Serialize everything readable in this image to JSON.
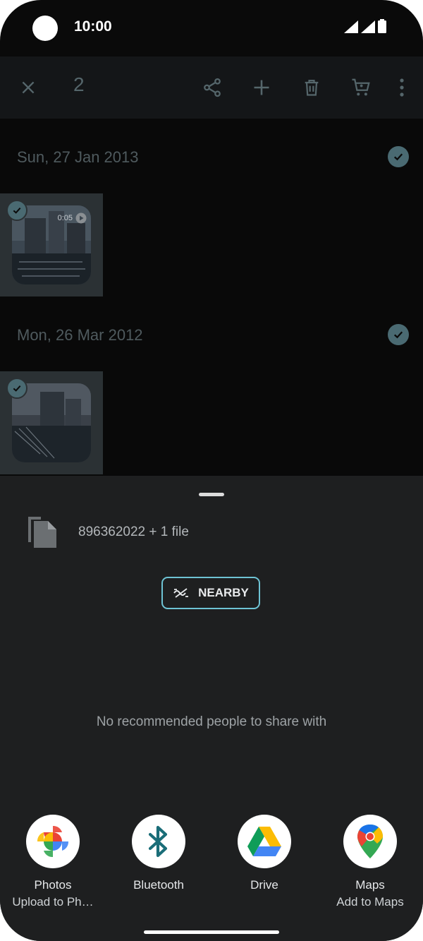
{
  "status_bar": {
    "time": "10:00"
  },
  "app_bar": {
    "selected_count": "2",
    "icons": [
      "close-icon",
      "share-icon",
      "add-icon",
      "delete-icon",
      "cart-icon",
      "more-vert-icon"
    ]
  },
  "groups": [
    {
      "date": "Sun, 27 Jan 2013",
      "duration": "0:05"
    },
    {
      "date": "Mon, 26 Mar 2012"
    }
  ],
  "share_sheet": {
    "file_label": "896362022 + 1 file",
    "nearby_label": "NEARBY",
    "no_people_text": "No recommended people to share with",
    "apps": [
      {
        "name": "Photos",
        "sub": "Upload to Ph…"
      },
      {
        "name": "Bluetooth",
        "sub": ""
      },
      {
        "name": "Drive",
        "sub": ""
      },
      {
        "name": "Maps",
        "sub": "Add to Maps"
      }
    ]
  },
  "colors": {
    "accent": "#6ec3d4",
    "sheet_bg": "#1e1f20",
    "check_bg": "#4a6a72"
  }
}
